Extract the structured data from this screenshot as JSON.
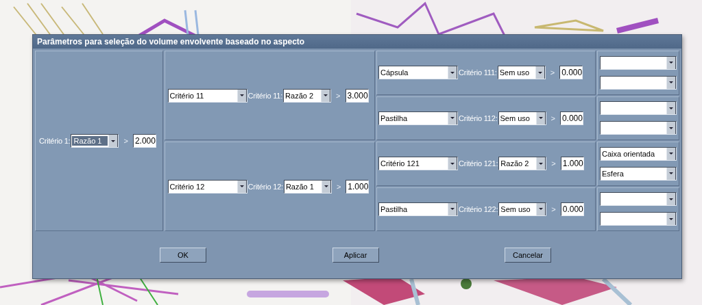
{
  "dialog": {
    "title": "Parâmetros para seleção do volume envolvente baseado no aspecto"
  },
  "root": {
    "label": "Critério 1:",
    "ratio": "Razão 1",
    "highlighted": true,
    "comparator": ">",
    "value": "2.000"
  },
  "level2": [
    {
      "type": "Critério 11",
      "label": "Critério 11:",
      "ratio": "Razão 2",
      "highlighted": false,
      "comparator": ">",
      "value": "3.000"
    },
    {
      "type": "Critério 12",
      "label": "Critério 12:",
      "ratio": "Razão 1",
      "highlighted": false,
      "comparator": ">",
      "value": "1.000"
    }
  ],
  "level3": [
    {
      "type": "Cápsula",
      "label": "Critério 111:",
      "ratio": "Sem uso",
      "highlighted": false,
      "comparator": ">",
      "value": "0.000"
    },
    {
      "type": "Pastilha",
      "label": "Critério 112:",
      "ratio": "Sem uso",
      "highlighted": false,
      "comparator": ">",
      "value": "0.000"
    },
    {
      "type": "Critério 121",
      "label": "Critério 121:",
      "ratio": "Razão 2",
      "highlighted": false,
      "comparator": ">",
      "value": "1.000",
      "shapes": [
        "Caixa orientada",
        "Esfera"
      ]
    },
    {
      "type": "Pastilha",
      "label": "Critério 122:",
      "ratio": "Sem uso",
      "highlighted": false,
      "comparator": ">",
      "value": "0.000"
    }
  ],
  "buttons": [
    {
      "label": "OK"
    },
    {
      "label": "Aplicar"
    },
    {
      "label": "Cancelar"
    }
  ]
}
